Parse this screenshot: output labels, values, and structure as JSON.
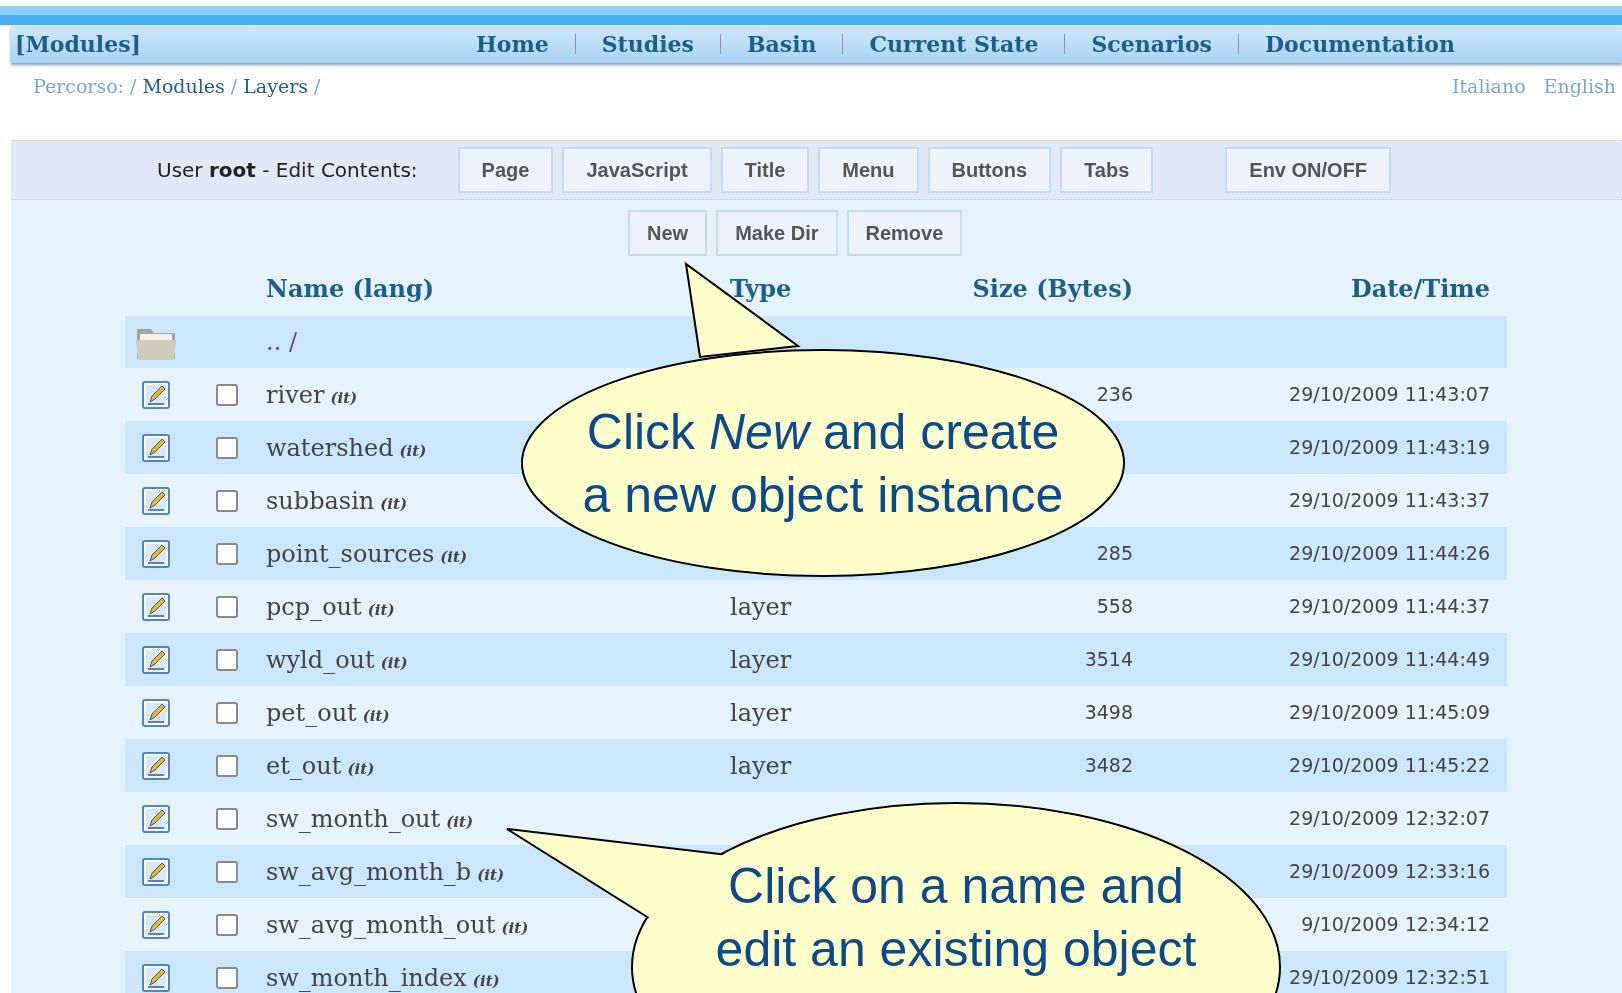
{
  "nav": {
    "title": "[Modules]",
    "links": [
      "Home",
      "Studies",
      "Basin",
      "Current State",
      "Scenarios",
      "Documentation"
    ]
  },
  "breadcrumb": [
    {
      "kind": "label",
      "text": "Percorso:"
    },
    {
      "kind": "separator",
      "text": "/"
    },
    {
      "kind": "link",
      "text": "Modules"
    },
    {
      "kind": "separator",
      "text": "/"
    },
    {
      "kind": "link",
      "text": "Layers"
    },
    {
      "kind": "separator",
      "text": "/"
    }
  ],
  "languages": [
    "Italiano",
    "English"
  ],
  "edit_bar": {
    "user_text": "User **root** - Edit Contents:",
    "buttons": [
      "Page",
      "JavaScript",
      "Title",
      "Menu",
      "Buttons",
      "Tabs"
    ],
    "env_button": "Env ON/OFF"
  },
  "file_actions": [
    "New",
    "Make Dir",
    "Remove"
  ],
  "table": {
    "columns": [
      "Name (lang)",
      "Type",
      "Size (Bytes)",
      "Date/Time"
    ],
    "parent_row": {
      "name": ".. /"
    },
    "rows": [
      {
        "name": "river",
        "lang": "(it)",
        "size": "236",
        "date": "29/10/2009 11:43:07",
        "checked": false
      },
      {
        "name": "watershed",
        "lang": "(it)",
        "date": "29/10/2009 11:43:19",
        "checked": false
      },
      {
        "name": "subbasin",
        "lang": "(it)",
        "date": "29/10/2009 11:43:37",
        "checked": false
      },
      {
        "name": "point_sources",
        "lang": "(it)",
        "size": "285",
        "date": "29/10/2009 11:44:26",
        "checked": false
      },
      {
        "name": "pcp_out",
        "lang": "(it)",
        "type": "layer",
        "size": "558",
        "date": "29/10/2009 11:44:37",
        "checked": false
      },
      {
        "name": "wyld_out",
        "lang": "(it)",
        "type": "layer",
        "size": "3514",
        "date": "29/10/2009 11:44:49",
        "checked": false
      },
      {
        "name": "pet_out",
        "lang": "(it)",
        "type": "layer",
        "size": "3498",
        "date": "29/10/2009 11:45:09",
        "checked": false
      },
      {
        "name": "et_out",
        "lang": "(it)",
        "type": "layer",
        "size": "3482",
        "date": "29/10/2009 11:45:22",
        "checked": false
      },
      {
        "name": "sw_month_out",
        "lang": "(it)",
        "date": "29/10/2009 12:32:07",
        "checked": false
      },
      {
        "name": "sw_avg_month_b",
        "lang": "(it)",
        "date": "29/10/2009 12:33:16",
        "checked": false
      },
      {
        "name": "sw_avg_month_out",
        "lang": "(it)",
        "date": "9/10/2009 12:34:12",
        "checked": false
      },
      {
        "name": "sw_month_index",
        "lang": "(it)",
        "date": "29/10/2009 12:32:51",
        "checked": false
      }
    ]
  },
  "callouts": [
    {
      "lines": [
        "Click *New* and create",
        "a new object instance"
      ]
    },
    {
      "lines": [
        "Click on a name and",
        "edit an existing object"
      ]
    }
  ]
}
